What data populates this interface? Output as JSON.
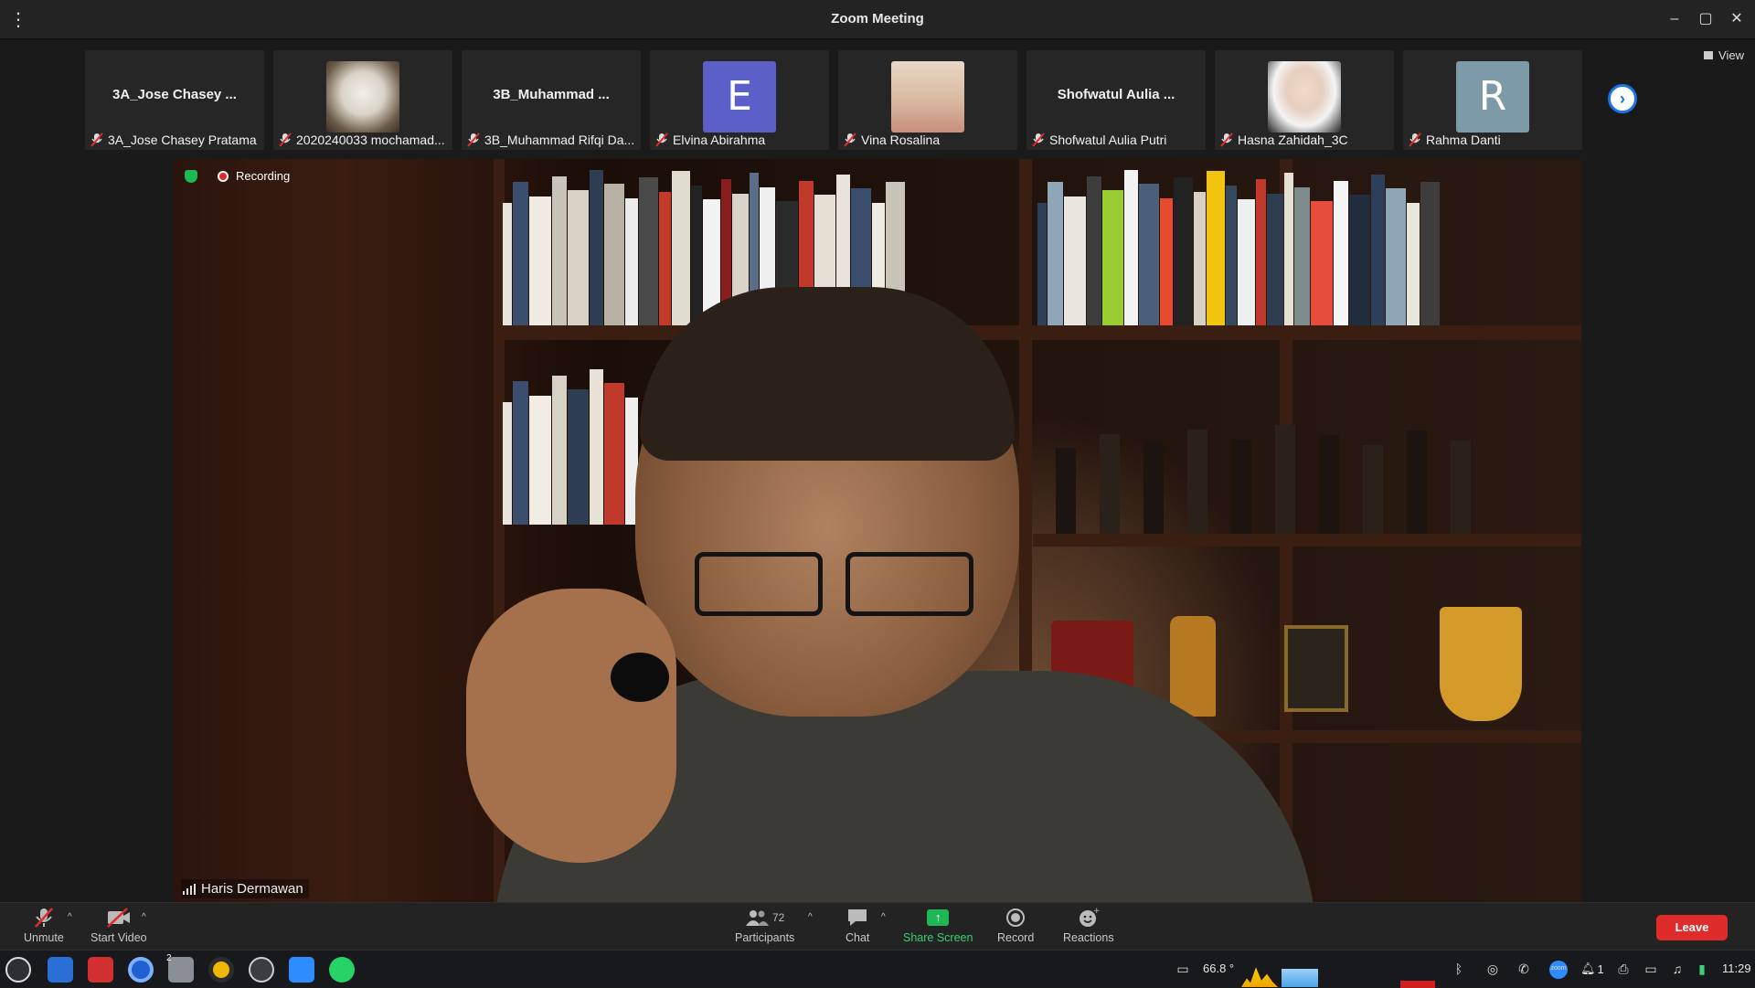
{
  "window": {
    "title": "Zoom Meeting"
  },
  "view_label": "View",
  "participants_strip": [
    {
      "tile_text": "3A_Jose Chasey ...",
      "label": "3A_Jose Chasey Pratama",
      "kind": "name"
    },
    {
      "tile_text": "",
      "label": "2020240033 mochamad...",
      "kind": "photo-wolf"
    },
    {
      "tile_text": "3B_Muhammad ...",
      "label": "3B_Muhammad Rifqi Da...",
      "kind": "name"
    },
    {
      "tile_text": "E",
      "label": "Elvina Abirahma",
      "kind": "letter",
      "color": "#5b5fc7"
    },
    {
      "tile_text": "",
      "label": "Vina Rosalina",
      "kind": "photo-room"
    },
    {
      "tile_text": "Shofwatul Aulia ...",
      "label": "Shofwatul Aulia Putri",
      "kind": "name"
    },
    {
      "tile_text": "",
      "label": "Hasna Zahidah_3C",
      "kind": "photo-portrait"
    },
    {
      "tile_text": "R",
      "label": "Rahma Danti",
      "kind": "letter",
      "color": "#7d9aa8"
    }
  ],
  "speaker": {
    "name": "Haris Dermawan",
    "recording_label": "Recording"
  },
  "toolbar": {
    "unmute": "Unmute",
    "start_video": "Start Video",
    "participants": "Participants",
    "participants_count": "72",
    "chat": "Chat",
    "share_screen": "Share Screen",
    "record": "Record",
    "reactions": "Reactions",
    "leave": "Leave"
  },
  "taskbar": {
    "temperature": "66.8 °",
    "clock": "11:29",
    "notification_count": "1",
    "files_badge": "2"
  },
  "colors": {
    "accent_green": "#1fb655",
    "leave_red": "#e02b2b",
    "link_blue": "#1a73e8"
  }
}
